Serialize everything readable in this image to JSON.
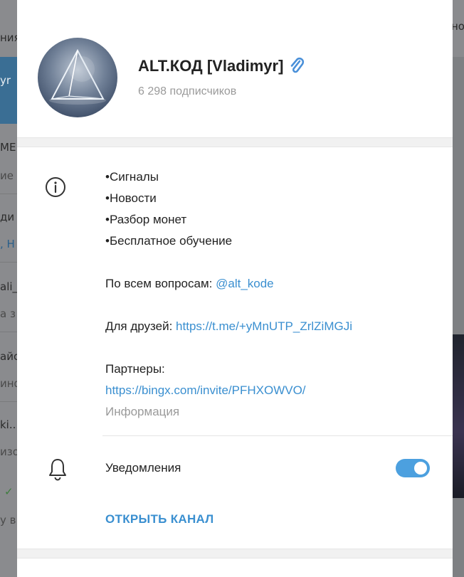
{
  "background": {
    "left_fragments": [
      "ния",
      "yr",
      "МЕ",
      "ие",
      "ди",
      ", Н",
      "ali_",
      "a з",
      "айс",
      "инф",
      "ki...",
      "изо",
      "✓",
      "у в"
    ],
    "right_fragment": "но"
  },
  "channel": {
    "name": "ALT.КОД [Vladimyr]",
    "subscribers": "6 298 подписчиков"
  },
  "description": {
    "bullets": [
      "•Сигналы",
      "•Новости",
      "•Разбор монет",
      "•Бесплатное обучение"
    ],
    "questions_label": "По всем вопросам: ",
    "questions_link": "@alt_kode",
    "friends_label": "Для друзей: ",
    "friends_link": "https://t.me/+yMnUTP_ZrlZiMGJi",
    "partners_label": "Партнеры:",
    "partners_link": "https://bingx.com/invite/PFHXOWVO/",
    "caption": "Информация"
  },
  "notifications": {
    "label": "Уведомления",
    "enabled": true
  },
  "actions": {
    "open_channel": "ОТКРЫТЬ КАНАЛ"
  },
  "colors": {
    "accent": "#3a8fd0",
    "toggle": "#4ca0df",
    "muted": "#9a9a9a"
  }
}
